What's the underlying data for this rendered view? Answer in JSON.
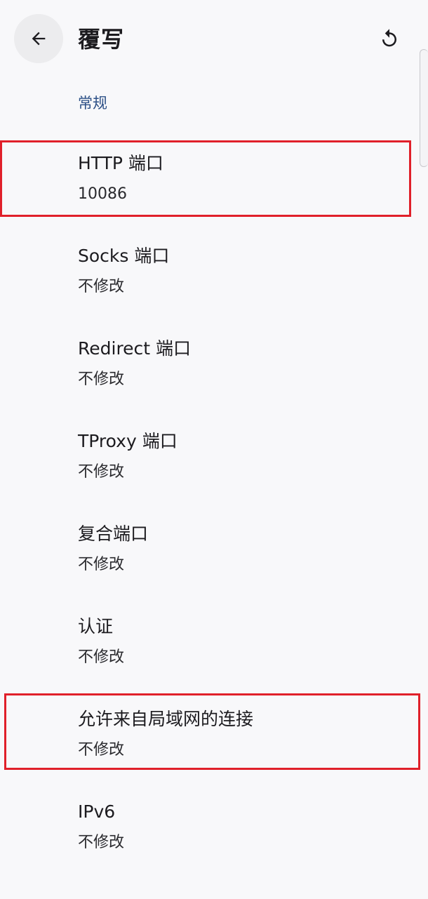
{
  "header": {
    "title": "覆写",
    "back_icon": "arrow-left-icon",
    "reset_icon": "refresh-icon"
  },
  "section": {
    "title": "常规"
  },
  "items": [
    {
      "title": "HTTP 端口",
      "summary": "10086"
    },
    {
      "title": "Socks 端口",
      "summary": "不修改"
    },
    {
      "title": "Redirect 端口",
      "summary": "不修改"
    },
    {
      "title": "TProxy 端口",
      "summary": "不修改"
    },
    {
      "title": "复合端口",
      "summary": "不修改"
    },
    {
      "title": "认证",
      "summary": "不修改"
    },
    {
      "title": "允许来自局域网的连接",
      "summary": "不修改"
    },
    {
      "title": "IPv6",
      "summary": "不修改"
    }
  ],
  "colors": {
    "background": "#f8f8fa",
    "section_accent": "#2c4f86",
    "highlight": "#e0202a"
  }
}
